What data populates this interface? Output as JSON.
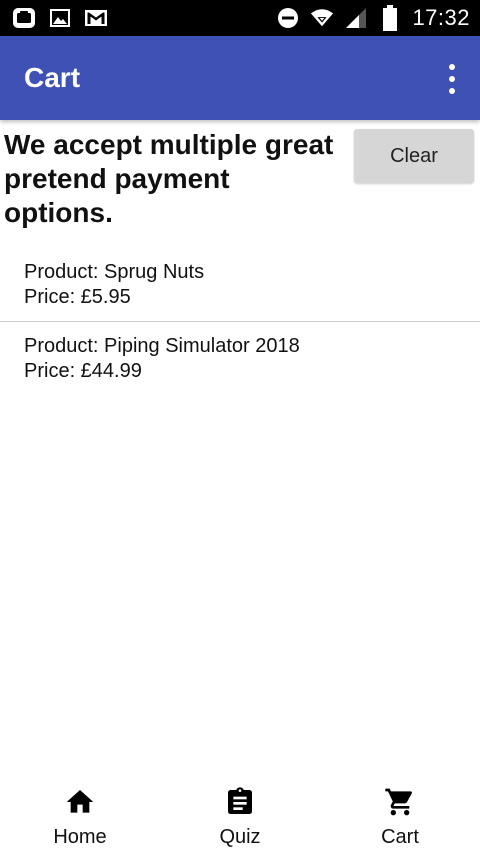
{
  "status_bar": {
    "time": "17:32",
    "left_icons": [
      "app-icon",
      "image-icon",
      "gmail-icon"
    ],
    "right_icons": [
      "do-not-disturb-icon",
      "wifi-icon",
      "signal-icon",
      "battery-icon"
    ]
  },
  "app_bar": {
    "title": "Cart",
    "menu_icon": "overflow-menu-icon",
    "color": "#3f51b5"
  },
  "main": {
    "headline": "We accept multiple great pretend payment options.",
    "clear_label": "Clear",
    "items": [
      {
        "product": "Product: Sprug Nuts",
        "price": "Price: £5.95"
      },
      {
        "product": "Product: Piping Simulator 2018",
        "price": "Price: £44.99"
      }
    ]
  },
  "bottom_nav": {
    "items": [
      {
        "label": "Home",
        "icon": "home-icon"
      },
      {
        "label": "Quiz",
        "icon": "clipboard-icon"
      },
      {
        "label": "Cart",
        "icon": "cart-icon"
      }
    ]
  }
}
